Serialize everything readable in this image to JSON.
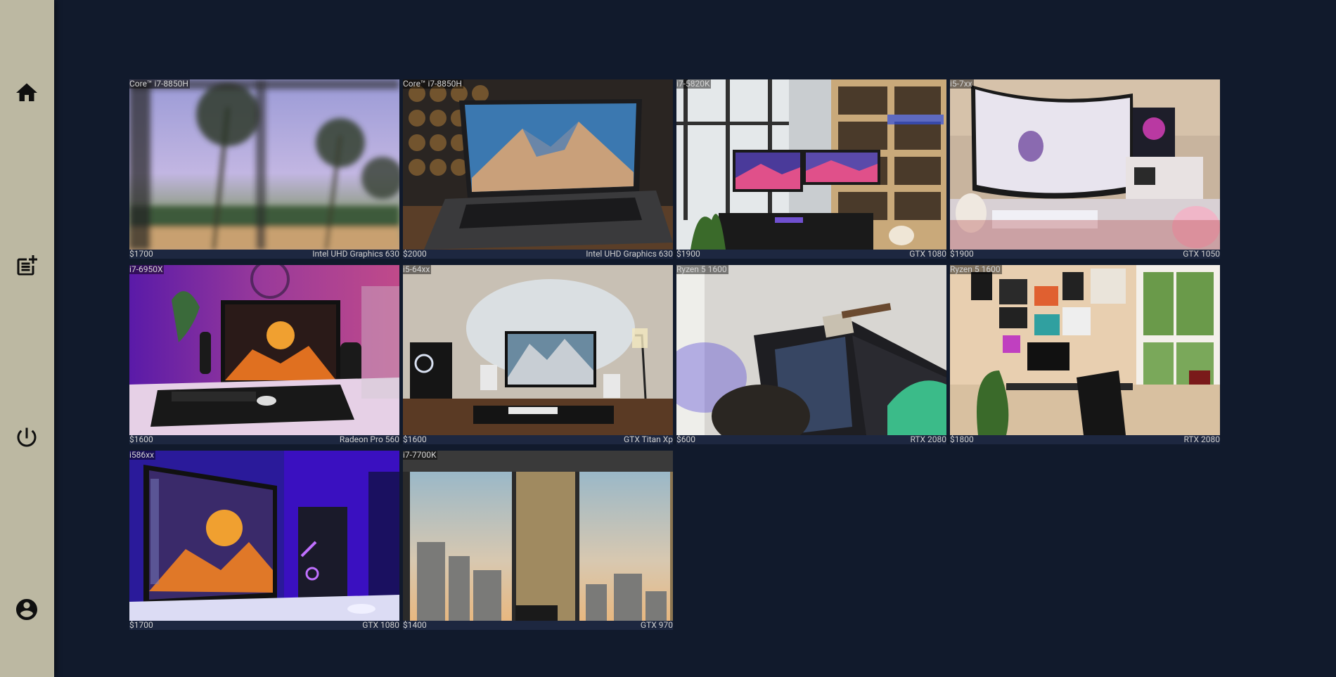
{
  "sidebar": {
    "items": [
      {
        "icon": "home-icon",
        "name": "nav-home"
      },
      {
        "icon": "post-add-icon",
        "name": "nav-post"
      },
      {
        "icon": "power-icon",
        "name": "nav-power"
      },
      {
        "icon": "account-icon",
        "name": "nav-account"
      }
    ]
  },
  "listings": [
    {
      "cpu": "Core™ i7-8850H",
      "price": "$1700",
      "gpu": "Intel UHD Graphics 630"
    },
    {
      "cpu": "Core™ i7-8850H",
      "price": "$2000",
      "gpu": "Intel UHD Graphics 630"
    },
    {
      "cpu": "i7-5820K",
      "price": "$1900",
      "gpu": "GTX 1080"
    },
    {
      "cpu": "i5-7xx",
      "price": "$1900",
      "gpu": "GTX 1050"
    },
    {
      "cpu": "i7-6950X",
      "price": "$1600",
      "gpu": "Radeon Pro 560"
    },
    {
      "cpu": "i5-64xx",
      "price": "$1600",
      "gpu": "GTX Titan Xp"
    },
    {
      "cpu": "Ryzen 5 1600",
      "price": "$600",
      "gpu": "RTX 2080"
    },
    {
      "cpu": "Ryzen 5 1600",
      "price": "$1800",
      "gpu": "RTX 2080"
    },
    {
      "cpu": "i586xx",
      "price": "$1700",
      "gpu": "GTX 1080"
    },
    {
      "cpu": "i7-7700K",
      "price": "$1400",
      "gpu": "GTX 970"
    }
  ],
  "colors": {
    "background": "#111a2c",
    "sidebar": "#bcb8a2",
    "card": "#1d2740"
  }
}
